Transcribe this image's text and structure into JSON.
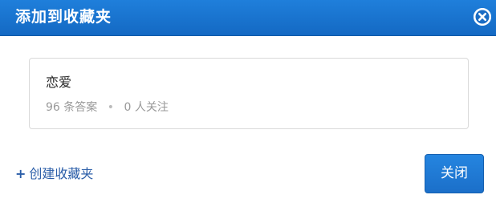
{
  "dialog": {
    "title": "添加到收藏夹",
    "close_icon": "close-icon"
  },
  "collections": [
    {
      "name": "恋爱",
      "answers_count": "96",
      "answers_label": "条答案",
      "separator": "•",
      "followers_count": "0",
      "followers_label": "人关注"
    }
  ],
  "footer": {
    "create_plus": "+",
    "create_label": "创建收藏夹",
    "close_button_label": "关闭"
  },
  "colors": {
    "titlebar": "#1a74d2",
    "link": "#2a5da8",
    "primary_button": "#1f7ad6"
  }
}
